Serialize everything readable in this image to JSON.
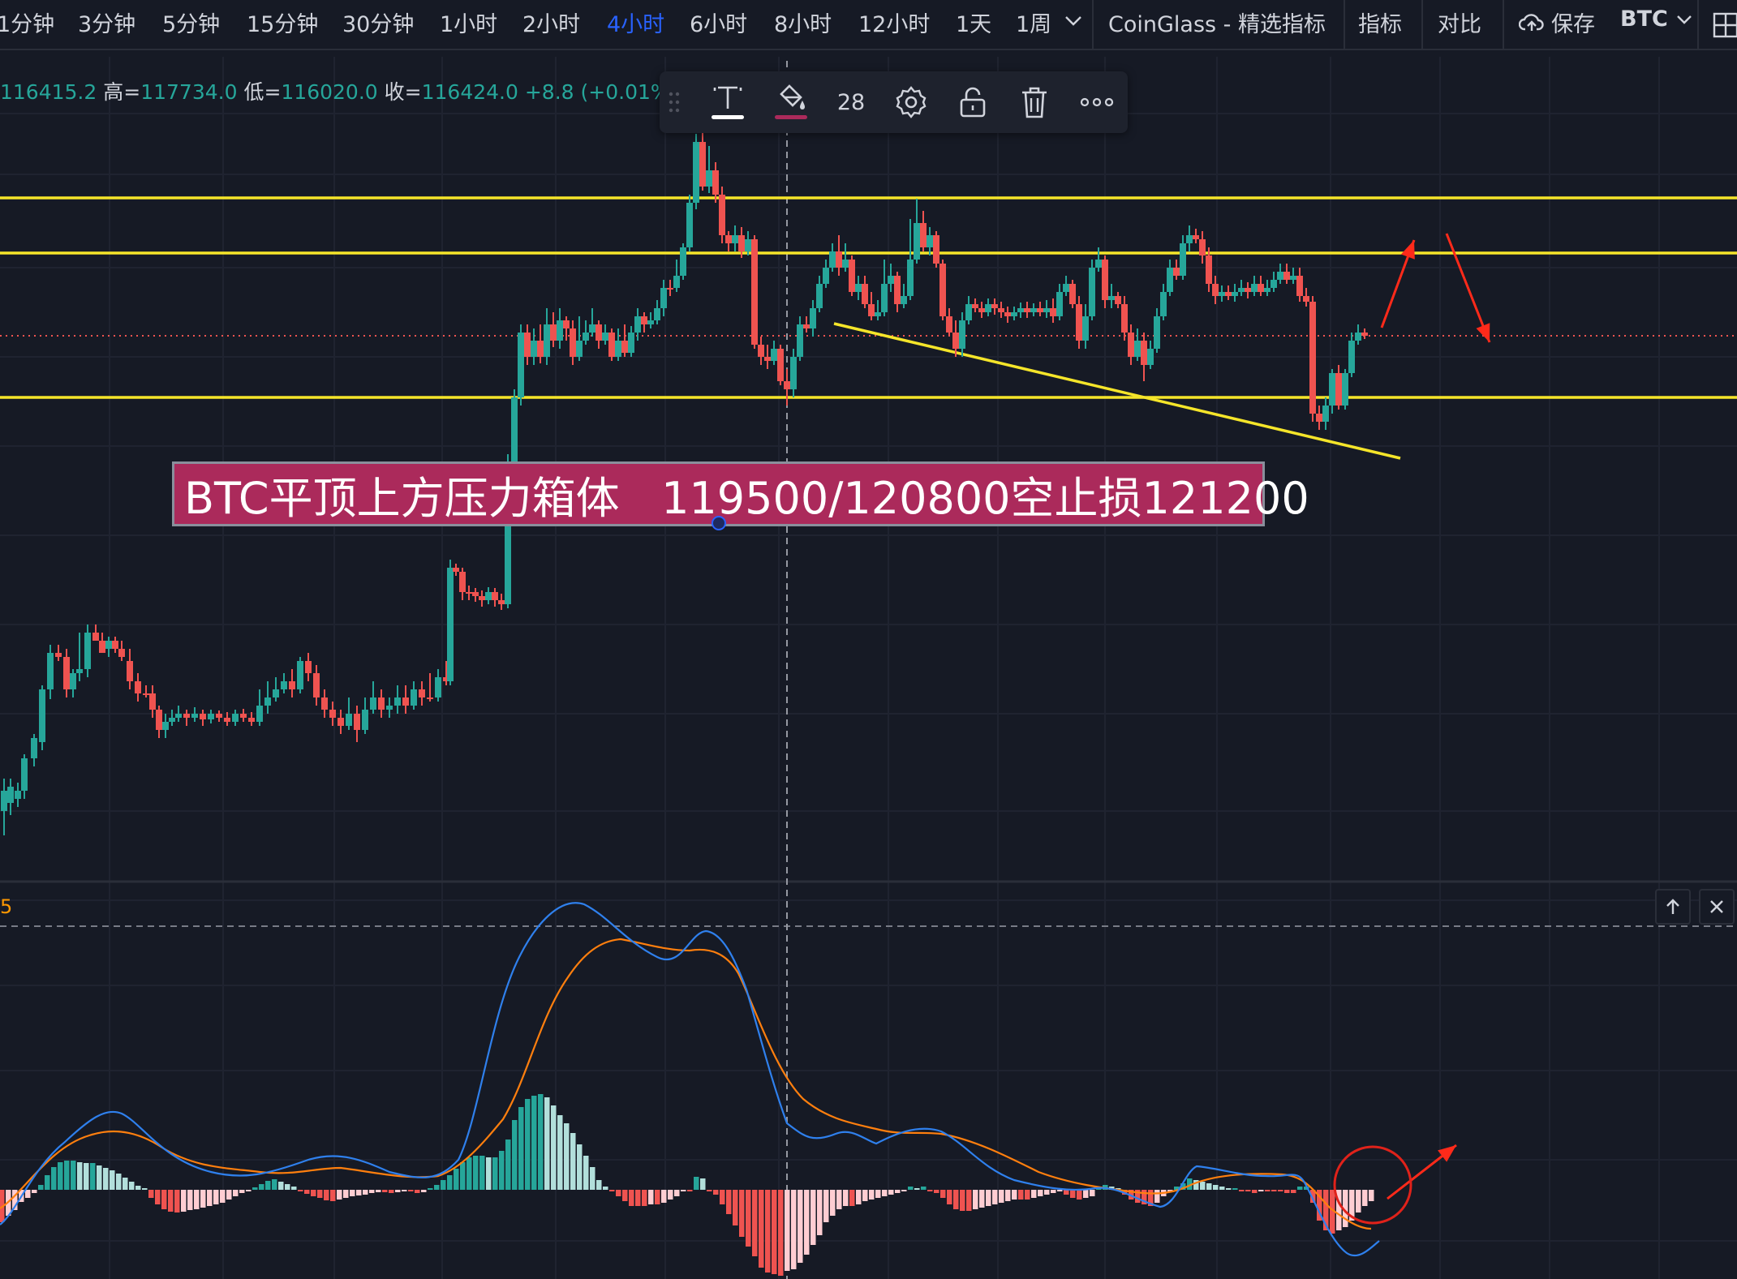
{
  "toolbar": {
    "timeframes": [
      "1分钟",
      "3分钟",
      "5分钟",
      "15分钟",
      "30分钟",
      "1小时",
      "2小时",
      "4小时",
      "6小时",
      "8小时",
      "12小时",
      "1天",
      "1周"
    ],
    "active_timeframe": "4小时",
    "indicator_name": "CoinGlass - 精选指标",
    "indicators_label": "指标",
    "compare_label": "对比",
    "save_label": "保存",
    "symbol": "BTC"
  },
  "ohlc": {
    "open_value": "116415.2",
    "high_key": "高=",
    "high_value": "117734.0",
    "low_key": "低=",
    "low_value": "116020.0",
    "close_key": "收=",
    "close_value": "116424.0",
    "change": "+8.8 (+0.01%)"
  },
  "drawing_toolbar": {
    "font_size": "28"
  },
  "annotation": {
    "text": "BTC平顶上方压力箱体   119500/120800空止损121200"
  },
  "macd_pane": {
    "label": "5"
  },
  "colors": {
    "background": "#161a25",
    "up": "#26a69a",
    "down": "#ef5350",
    "level_line": "#f5e52a",
    "arrow": "#ff2a1a",
    "label_bg": "#ab2a5b",
    "macd_line": "#2f80ed",
    "signal_line": "#ff7f0e"
  }
}
